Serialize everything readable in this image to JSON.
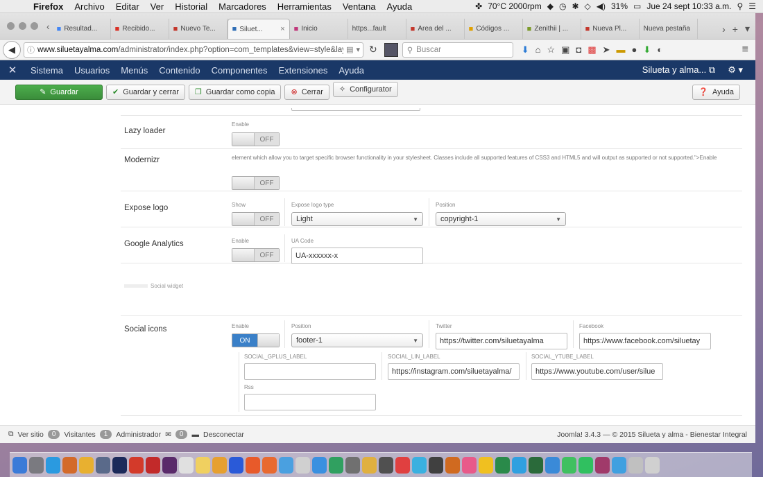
{
  "menubar": {
    "items": [
      "Firefox",
      "Archivo",
      "Editar",
      "Ver",
      "Historial",
      "Marcadores",
      "Herramientas",
      "Ventana",
      "Ayuda"
    ],
    "status_temp": "70°C 2000rpm",
    "battery": "31%",
    "clock": "Jue 24 sept  10:33 a.m."
  },
  "tabs": [
    {
      "label": "Resultad...",
      "icon": "google-g",
      "color": "#4285f4"
    },
    {
      "label": "Recibido...",
      "icon": "gmail-m",
      "color": "#d93025"
    },
    {
      "label": "Nuevo Te...",
      "icon": "w-logo",
      "color": "#c3362b"
    },
    {
      "label": "Siluet...",
      "icon": "joomla-logo",
      "color": "#2f6db5",
      "active": true,
      "close": "×"
    },
    {
      "label": "Inicio",
      "icon": "app-logo",
      "color": "#c0367a"
    },
    {
      "label": "https...fault",
      "icon": "",
      "color": "#777"
    },
    {
      "label": "Área del ...",
      "icon": "w-logo",
      "color": "#c3362b"
    },
    {
      "label": "Códigos ...",
      "icon": "chrome-logo",
      "color": "#e0a000"
    },
    {
      "label": "Zenithii | ...",
      "icon": "x-logo",
      "color": "#7c9a2a"
    },
    {
      "label": "Nueva Pl...",
      "icon": "w-logo",
      "color": "#c3362b"
    },
    {
      "label": "Nueva pestaña",
      "icon": "",
      "color": "#777"
    }
  ],
  "navbar": {
    "url_domain": "www.siluetayalma.com",
    "url_path": "/administrator/index.php?option=com_templates&view=style&layo",
    "search_placeholder": "Buscar"
  },
  "jmenu": {
    "items": [
      "Sistema",
      "Usuarios",
      "Menús",
      "Contenido",
      "Componentes",
      "Extensiones",
      "Ayuda"
    ],
    "site": "Silueta y alma..."
  },
  "toolbar": {
    "save": "Guardar",
    "save_close": "Guardar y cerrar",
    "save_copy": "Guardar como copia",
    "close": "Cerrar",
    "configurator": "Configurator",
    "help": "Ayuda"
  },
  "form": {
    "lazy": {
      "label": "Lazy loader",
      "cap": "Enable",
      "state": "OFF"
    },
    "modernizr": {
      "label": "Modernizr",
      "desc": "element which allow you to target specific browser functionality in your stylesheet. Classes include all supported features of CSS3 and HTML5 and will output as supported or not supported.\">Enable",
      "state": "OFF"
    },
    "expose": {
      "label": "Expose logo",
      "cap": "Show",
      "state": "OFF",
      "type_cap": "Expose logo type",
      "type_value": "Light",
      "pos_cap": "Position",
      "pos_value": "copyright-1"
    },
    "ga": {
      "label": "Google Analytics",
      "cap": "Enable",
      "state": "OFF",
      "ua_cap": "UA Code",
      "ua_value": "UA-xxxxxx-x"
    },
    "social_widget": "Social widget",
    "social": {
      "label": "Social icons",
      "cap": "Enable",
      "state": "ON",
      "pos_cap": "Position",
      "pos_value": "footer-1",
      "twitter_cap": "Twitter",
      "twitter_value": "https://twitter.com/siluetayalma",
      "facebook_cap": "Facebook",
      "facebook_value": "https://www.facebook.com/siluetay",
      "gplus_cap": "SOCIAL_GPLUS_LABEL",
      "gplus_value": "",
      "lin_cap": "SOCIAL_LIN_LABEL",
      "lin_value": "https://instagram.com/siluetayalma/",
      "ytube_cap": "SOCIAL_YTUBE_LABEL",
      "ytube_value": "https://www.youtube.com/user/silue",
      "rss_cap": "Rss",
      "rss_value": ""
    }
  },
  "statusbar": {
    "view_site": "Ver sitio",
    "visitors_count": "0",
    "visitors": "Visitantes",
    "admin_count": "1",
    "admin": "Administrador",
    "msg_count": "0",
    "logout": "Desconectar",
    "right": "Joomla! 3.4.3  —  © 2015 Silueta y alma - Bienestar Integral"
  },
  "dock_colors": [
    "#3b7bd8",
    "#7a7a80",
    "#2a9ae0",
    "#d36a2a",
    "#e8b030",
    "#5a6a8a",
    "#1c2a5a",
    "#d33a2a",
    "#c22a2a",
    "#5a2a6a",
    "#e0e0e0",
    "#f0d060",
    "#e6a030",
    "#2a5ad8",
    "#e85a2a",
    "#e86a30",
    "#4aa0e0",
    "#d0d0d0",
    "#3a90e0",
    "#30a060",
    "#707070",
    "#e0b040",
    "#505050",
    "#e04040",
    "#3ab0e0",
    "#404040",
    "#d06a20",
    "#e85a8a",
    "#f0c020",
    "#2a8a4a",
    "#30a0e0",
    "#2a6a3a",
    "#3a8ad8",
    "#40c060",
    "#30c060",
    "#a03a6a",
    "#40a0e0",
    "#c0c0c0",
    "#d0d0d0"
  ]
}
